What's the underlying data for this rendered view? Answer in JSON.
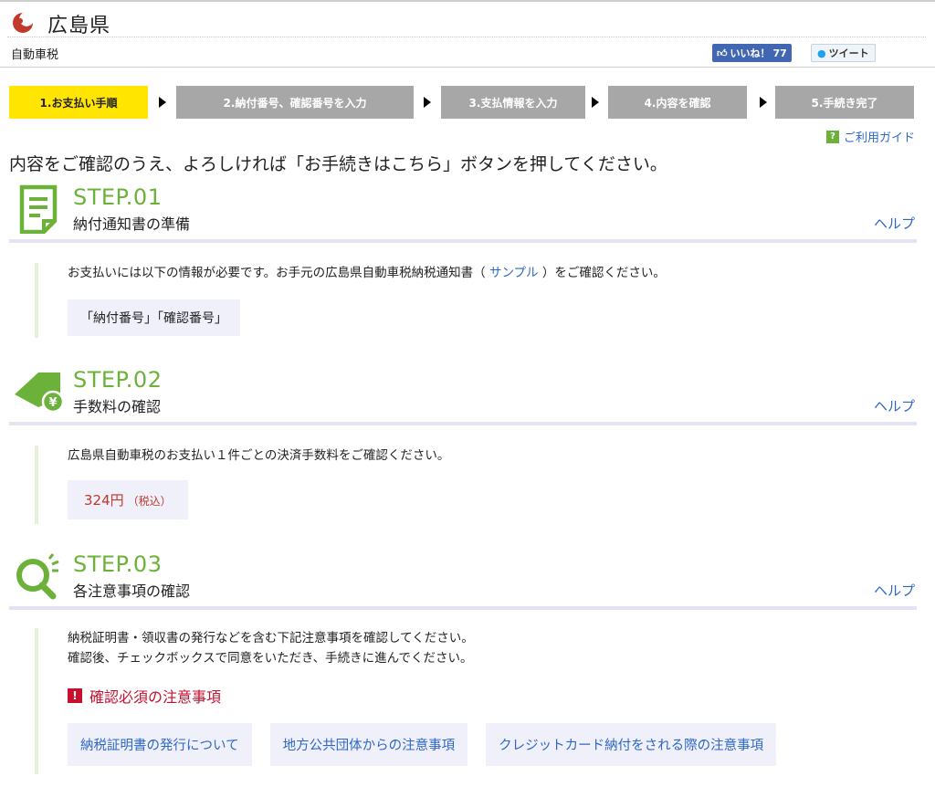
{
  "header": {
    "pref_name": "広島県",
    "service": "自動車税",
    "like_label": "いいね！",
    "like_count": "77",
    "tweet_label": "ツイート"
  },
  "progress": {
    "steps": [
      {
        "label": "1.お支払い手順",
        "active": true
      },
      {
        "label": "2.納付番号、確認番号を入力",
        "active": false
      },
      {
        "label": "3.支払情報を入力",
        "active": false
      },
      {
        "label": "4.内容を確認",
        "active": false
      },
      {
        "label": "5.手続き完了",
        "active": false
      }
    ]
  },
  "guide_link": "ご利用ガイド",
  "instruction": "内容をご確認のうえ、よろしければ「お手続きはこちら」ボタンを押してください。",
  "steps": [
    {
      "title": "STEP.01",
      "subtitle": "納付通知書の準備",
      "help": "ヘルプ",
      "body_pre": "お支払いには以下の情報が必要です。お手元の広島県自動車税納税通知書（",
      "body_link": "サンプル",
      "body_post": "）をご確認ください。",
      "box": "「納付番号」「確認番号」"
    },
    {
      "title": "STEP.02",
      "subtitle": "手数料の確認",
      "help": "ヘルプ",
      "body": "広島県自動車税のお支払い１件ごとの決済手数料をご確認ください。",
      "fee": "324円",
      "fee_note": "（税込）"
    },
    {
      "title": "STEP.03",
      "subtitle": "各注意事項の確認",
      "help": "ヘルプ",
      "body_line1": "納税証明書・領収書の発行などを含む下記注意事項を確認してください。",
      "body_line2": "確認後、チェックボックスで同意をいただき、手続きに進んでください。",
      "required_label": "確認必須の注意事項",
      "notices": [
        "納税証明書の発行について",
        "地方公共団体からの注意事項",
        "クレジットカード納付をされる際の注意事項"
      ]
    }
  ],
  "colors": {
    "accent_green": "#6cb23a",
    "active_step": "#ffe500",
    "inactive_step": "#a7a7a7",
    "link_blue": "#2e67c6",
    "warning_red": "#c8102e"
  }
}
